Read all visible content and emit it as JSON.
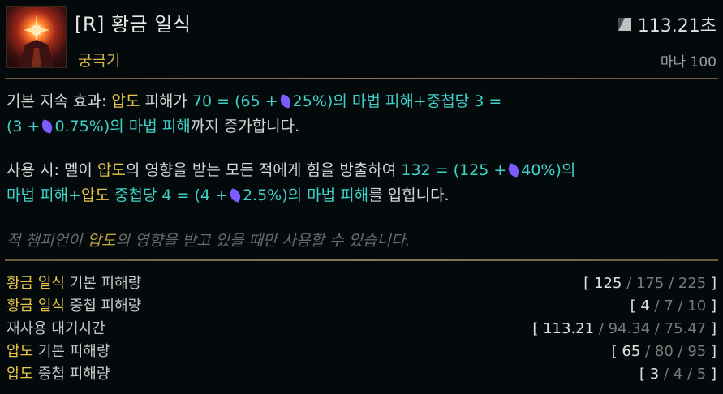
{
  "header": {
    "title": "[R] 황금 일식",
    "subtitle": "궁극기",
    "cooldown": "113.21초",
    "cost": "마나 100"
  },
  "passive": {
    "label": "기본 지속 효과",
    "colon": ":",
    "mark": "압도",
    "t1": "피해가",
    "dmg": "70 = (65 +",
    "ratio1": "25%)의 마법 피해+중첩당 3 =",
    "line2a": "(3 +",
    "ratio2": "0.75%)의 마법 피해",
    "tail": "까지 증가합니다."
  },
  "active": {
    "label": "사용 시",
    "colon": ":",
    "t1": "멜이",
    "mark": "압도",
    "t2": "의 영향을 받는 모든 적에게 힘을 방출하여",
    "dmg": "132 = (125 +",
    "ratio1": "40%)의",
    "line2a": "마법 피해+",
    "mark2": "압도",
    "t3": "중첩당 4 = (4 +",
    "ratio2": "2.5%)의 마법 피해",
    "tail": "를 입힙니다."
  },
  "note": {
    "pre": "적 챔피언이",
    "mark": "압도",
    "post": "의 영향을 받고 있을 때만 사용할 수 있습니다."
  },
  "stats": [
    {
      "name_hl": "황금 일식",
      "name_rest": "기본 피해량",
      "open": "[",
      "v1": "125",
      "sep1": "/",
      "v2": "175",
      "sep2": "/",
      "v3": "225",
      "close": "]"
    },
    {
      "name_hl": "황금 일식",
      "name_rest": "중첩 피해량",
      "open": "[",
      "v1": "4",
      "sep1": "/",
      "v2": "7",
      "sep2": "/",
      "v3": "10",
      "close": "]"
    },
    {
      "name_hl": "",
      "name_rest": "재사용 대기시간",
      "open": "[",
      "v1": "113.21",
      "sep1": "/",
      "v2": "94.34",
      "sep2": "/",
      "v3": "75.47",
      "close": "]"
    },
    {
      "name_hl": "압도",
      "name_rest": "기본 피해량",
      "open": "[",
      "v1": "65",
      "sep1": "/",
      "v2": "80",
      "sep2": "/",
      "v3": "95",
      "close": "]"
    },
    {
      "name_hl": "압도",
      "name_rest": "중첩 피해량",
      "open": "[",
      "v1": "3",
      "sep1": "/",
      "v2": "4",
      "sep2": "/",
      "v3": "5",
      "close": "]"
    }
  ]
}
